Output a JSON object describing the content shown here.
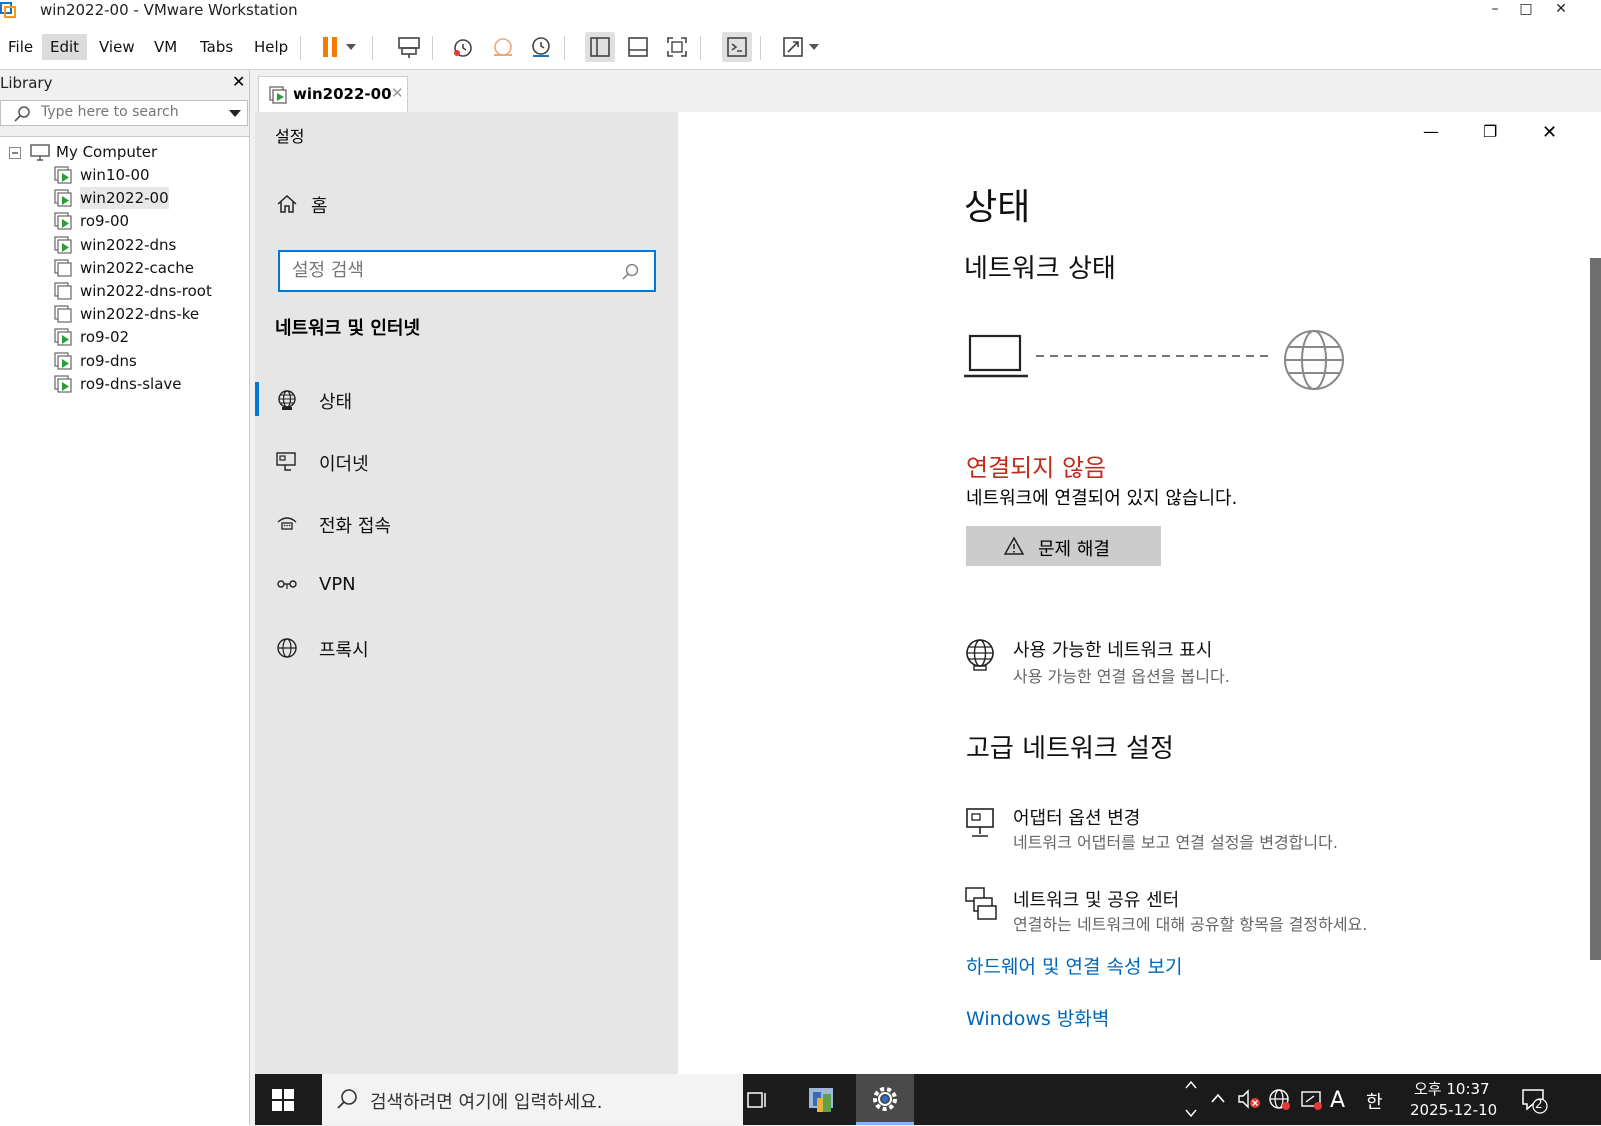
{
  "window": {
    "title": "win2022-00 - VMware Workstation",
    "minimize": "–",
    "maximize": "□",
    "close": "✕"
  },
  "menu": [
    "File",
    "Edit",
    "View",
    "VM",
    "Tabs",
    "Help"
  ],
  "library": {
    "title": "Library",
    "close": "✕",
    "search_placeholder": "Type here to search",
    "root": "My Computer",
    "items": [
      {
        "name": "win10-00",
        "state": "running"
      },
      {
        "name": "win2022-00",
        "state": "running",
        "selected": true
      },
      {
        "name": "ro9-00",
        "state": "running"
      },
      {
        "name": "win2022-dns",
        "state": "running"
      },
      {
        "name": "win2022-cache",
        "state": "off"
      },
      {
        "name": "win2022-dns-root",
        "state": "off"
      },
      {
        "name": "win2022-dns-ke",
        "state": "off"
      },
      {
        "name": "ro9-02",
        "state": "running"
      },
      {
        "name": "ro9-dns",
        "state": "running"
      },
      {
        "name": "ro9-dns-slave",
        "state": "running"
      }
    ]
  },
  "tab": {
    "label": "win2022-00",
    "close": "✕"
  },
  "settings": {
    "app_title": "설정",
    "home": "홈",
    "search_placeholder": "설정 검색",
    "section": "네트워크 및 인터넷",
    "nav": [
      {
        "label": "상태",
        "icon": "status-globe-icon",
        "active": true
      },
      {
        "label": "이더넷",
        "icon": "ethernet-icon"
      },
      {
        "label": "전화 접속",
        "icon": "dial-up-icon"
      },
      {
        "label": "VPN",
        "icon": "vpn-icon"
      },
      {
        "label": "프록시",
        "icon": "proxy-globe-icon"
      }
    ],
    "main": {
      "page_title": "상태",
      "network_status_heading": "네트워크 상태",
      "not_connected": "연결되지 않음",
      "not_connected_desc": "네트워크에 연결되어 있지 않습니다.",
      "troubleshoot_button": "문제 해결",
      "show_networks_title": "사용 가능한 네트워크 표시",
      "show_networks_sub": "사용 가능한 연결 옵션을 봅니다.",
      "advanced_heading": "고급 네트워크 설정",
      "adapter_title": "어댑터 옵션 변경",
      "adapter_sub": "네트워크 어댑터를 보고 연결 설정을 변경합니다.",
      "sharing_title": "네트워크 및 공유 센터",
      "sharing_sub": "연결하는 네트워크에 대해 공유할 항목을 결정하세요.",
      "hardware_link": "하드웨어 및 연결 속성 보기",
      "firewall_link": "Windows 방화벽"
    },
    "window_controls": {
      "minimize": "—",
      "restore": "❐",
      "close": "✕"
    },
    "error_color": "#c42b1c",
    "accent_color": "#0078d4",
    "link_color": "#0067b8"
  },
  "taskbar": {
    "search_placeholder": "검색하려면 여기에 입력하세요.",
    "ime_a": "A",
    "ime_han": "한",
    "time": "오후 10:37",
    "date": "2025-12-10",
    "notifications": "2"
  }
}
